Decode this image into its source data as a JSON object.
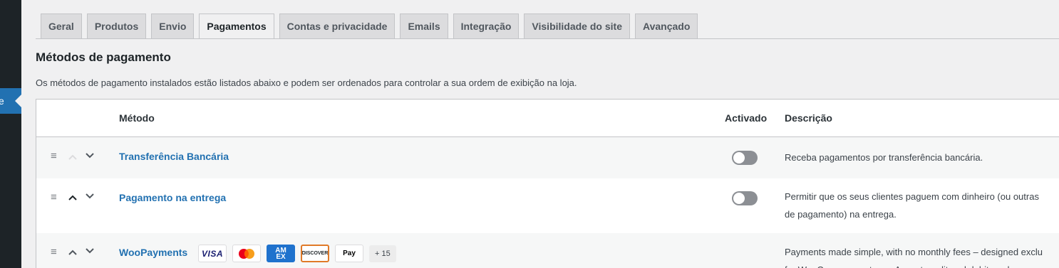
{
  "sidebar": {
    "current_label": "e"
  },
  "tabs": [
    {
      "label": "Geral"
    },
    {
      "label": "Produtos"
    },
    {
      "label": "Envio"
    },
    {
      "label": "Pagamentos",
      "active": true
    },
    {
      "label": "Contas e privacidade"
    },
    {
      "label": "Emails"
    },
    {
      "label": "Integração"
    },
    {
      "label": "Visibilidade do site"
    },
    {
      "label": "Avançado"
    }
  ],
  "section": {
    "title": "Métodos de pagamento",
    "description": "Os métodos de pagamento instalados estão listados abaixo e podem ser ordenados para controlar a sua ordem de exibição na loja."
  },
  "table": {
    "headers": {
      "method": "Método",
      "enabled": "Activado",
      "description": "Descrição"
    },
    "rows": [
      {
        "name": "Transferência Bancária",
        "enabled": false,
        "description_lines": [
          "Receba pagamentos por transferência bancária."
        ]
      },
      {
        "name": "Pagamento na entrega",
        "enabled": false,
        "description_lines": [
          "Permitir que os seus clientes paguem com dinheiro (ou outras",
          "de pagamento) na entrega."
        ]
      },
      {
        "name": "WooPayments",
        "enabled": null,
        "description_lines": [
          "Payments made simple, with no monthly fees – designed exclu",
          "for WooCommerce stores. Accept credit and debit cards"
        ],
        "payment_icons": {
          "visa": "VISA",
          "mastercard": "mastercard-icon",
          "amex_line1": "AM",
          "amex_line2": "EX",
          "discover": "DISCOVER",
          "applepay": "Pay",
          "more": "+ 15"
        }
      }
    ]
  },
  "colors": {
    "accent": "#2271b1",
    "sidebar": "#1d2327",
    "toggle_off": "#8c8f94"
  }
}
